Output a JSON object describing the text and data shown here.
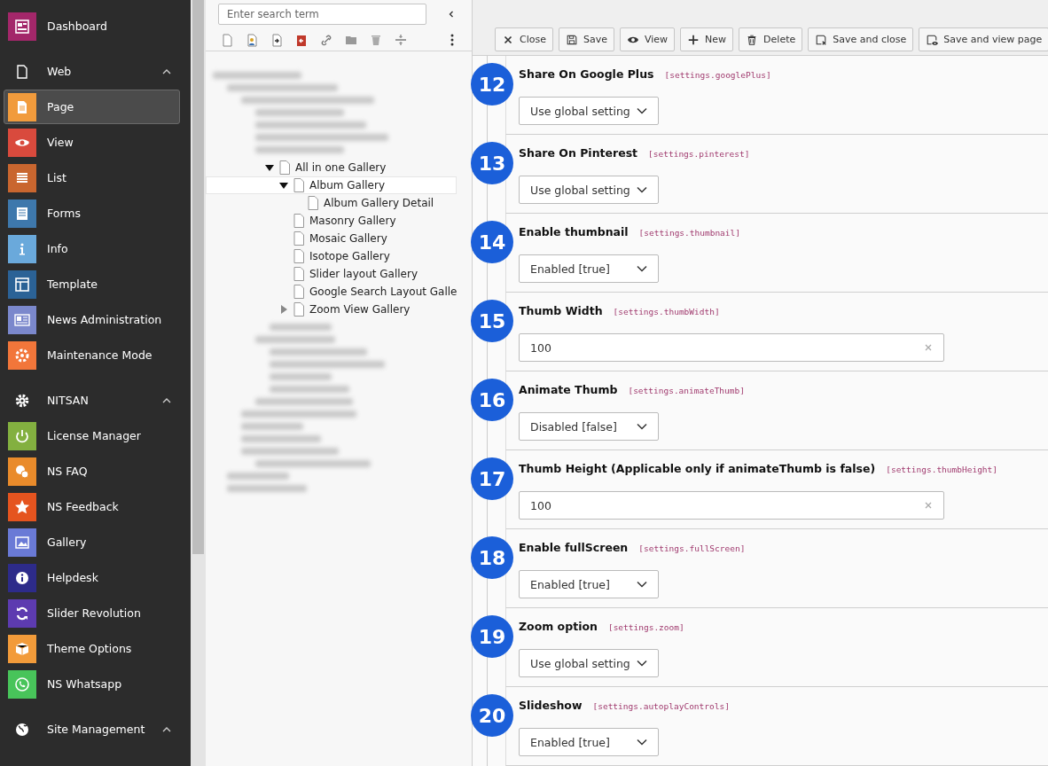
{
  "sidebar": {
    "items": [
      {
        "kind": "module",
        "label": "Dashboard",
        "color": "#a3276a",
        "selected": false
      },
      {
        "kind": "group",
        "label": "Web",
        "expanded": true
      },
      {
        "kind": "module",
        "label": "Page",
        "color": "#f19b3c",
        "selected": true
      },
      {
        "kind": "module",
        "label": "View",
        "color": "#d94a3d",
        "selected": false
      },
      {
        "kind": "module",
        "label": "List",
        "color": "#c9662f",
        "selected": false
      },
      {
        "kind": "module",
        "label": "Forms",
        "color": "#3e78ac",
        "selected": false
      },
      {
        "kind": "module",
        "label": "Info",
        "color": "#6aa9db",
        "selected": false
      },
      {
        "kind": "module",
        "label": "Template",
        "color": "#2b6296",
        "selected": false
      },
      {
        "kind": "module",
        "label": "News Administration",
        "color": "#7b88cc",
        "selected": false
      },
      {
        "kind": "module",
        "label": "Maintenance Mode",
        "color": "#f2763a",
        "selected": false
      },
      {
        "kind": "group",
        "label": "NITSAN",
        "expanded": true
      },
      {
        "kind": "module",
        "label": "License Manager",
        "color": "#83b040",
        "selected": false
      },
      {
        "kind": "module",
        "label": "NS FAQ",
        "color": "#e98b2b",
        "selected": false
      },
      {
        "kind": "module",
        "label": "NS Feedback",
        "color": "#e5541f",
        "selected": false
      },
      {
        "kind": "module",
        "label": "Gallery",
        "color": "#6a7ad6",
        "selected": false
      },
      {
        "kind": "module",
        "label": "Helpdesk",
        "color": "#2d2b8a",
        "selected": false
      },
      {
        "kind": "module",
        "label": "Slider Revolution",
        "color": "#5d3bb0",
        "selected": false
      },
      {
        "kind": "module",
        "label": "Theme Options",
        "color": "#f29b3a",
        "selected": false
      },
      {
        "kind": "module",
        "label": "NS Whatsapp",
        "color": "#48c45a",
        "selected": false
      },
      {
        "kind": "group",
        "label": "Site Management",
        "expanded": true
      }
    ]
  },
  "page_tree": {
    "search": {
      "placeholder": "Enter search term"
    },
    "items": [
      {
        "label": "All in one Gallery",
        "expanded": true,
        "selected": false,
        "children": [
          {
            "label": "Album Gallery",
            "expanded": true,
            "selected": true,
            "children": [
              {
                "label": "Album Gallery Detail",
                "selected": false
              }
            ]
          },
          {
            "label": "Masonry Gallery",
            "selected": false
          },
          {
            "label": "Mosaic Gallery",
            "selected": false
          },
          {
            "label": "Isotope Gallery",
            "selected": false
          },
          {
            "label": "Slider layout Gallery",
            "selected": false
          },
          {
            "label": "Google Search Layout Galle",
            "selected": false
          },
          {
            "label": "Zoom View Gallery",
            "expanded": false,
            "selected": false
          }
        ]
      }
    ]
  },
  "toolbar": {
    "buttons": [
      {
        "label": "Close"
      },
      {
        "label": "Save"
      },
      {
        "label": "View"
      },
      {
        "label": "New"
      },
      {
        "label": "Delete"
      },
      {
        "label": "Save and close"
      },
      {
        "label": "Save and view page"
      }
    ]
  },
  "form": {
    "fields": [
      {
        "number": "12",
        "label": "Share On Google Plus",
        "key": "[settings.googlePlus]",
        "kind": "select",
        "value": "Use global setting"
      },
      {
        "number": "13",
        "label": "Share On Pinterest",
        "key": "[settings.pinterest]",
        "kind": "select",
        "value": "Use global setting"
      },
      {
        "number": "14",
        "label": "Enable thumbnail",
        "key": "[settings.thumbnail]",
        "kind": "select",
        "value": "Enabled [true]"
      },
      {
        "number": "15",
        "label": "Thumb Width",
        "key": "[settings.thumbWidth]",
        "kind": "input",
        "value": "100"
      },
      {
        "number": "16",
        "label": "Animate Thumb",
        "key": "[settings.animateThumb]",
        "kind": "select",
        "value": "Disabled [false]"
      },
      {
        "number": "17",
        "label": "Thumb Height (Applicable only if animateThumb is false)",
        "key": "[settings.thumbHeight]",
        "kind": "input",
        "value": "100"
      },
      {
        "number": "18",
        "label": "Enable fullScreen",
        "key": "[settings.fullScreen]",
        "kind": "select",
        "value": "Enabled [true]"
      },
      {
        "number": "19",
        "label": "Zoom option",
        "key": "[settings.zoom]",
        "kind": "select",
        "value": "Use global setting"
      },
      {
        "number": "20",
        "label": "Slideshow",
        "key": "[settings.autoplayControls]",
        "kind": "select",
        "value": "Enabled [true]"
      }
    ]
  }
}
